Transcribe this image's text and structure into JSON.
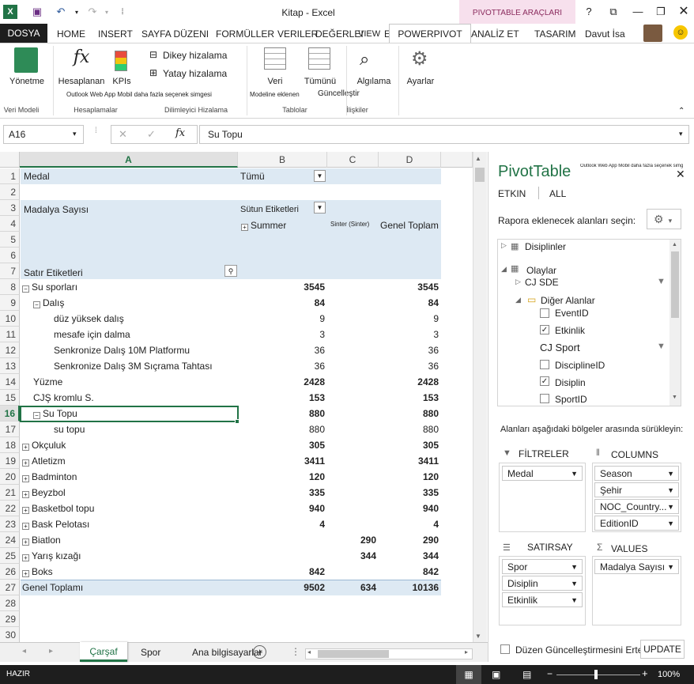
{
  "window": {
    "title": "Kitap - Excel",
    "tools_label": "PIVOTTABLE ARAÇLARI",
    "help": "?",
    "user": "Davut İsa"
  },
  "tabs": {
    "file": "DOSYA",
    "items": [
      "HOME",
      "INSERT",
      "SAYFA DÜZENI",
      "FORMÜLLER",
      "VERILER",
      "DEĞERLEI",
      "VIEW",
      "E"
    ],
    "powerpivot": "POWERPIVOT işlevi",
    "analyze": "ANALİZ ET",
    "design": "TASARIM"
  },
  "ribbon": {
    "manage": "Yönetme",
    "calc": "Hesaplanan",
    "kpis": "KPIs",
    "vertical": "Dikey hizalama",
    "horizontal": "Yatay hizalama",
    "outlook_note": "Outlook Web App Mobil daha fazla seçenek simgesi",
    "data": "Veri",
    "refresh": "Tümünü",
    "model_note": "Modeline eklenen",
    "refresh2": "Güncelleştir",
    "detect": "Algılama",
    "settings": "Ayarlar",
    "groups": {
      "model": "Veri Modeli",
      "calc": "Hesaplamalar",
      "slicer": "Dilimleyici Hizalama",
      "tables": "Tablolar",
      "relations": "İlişkiler"
    }
  },
  "formula": {
    "namebox": "A16",
    "fx": "fx",
    "value": "Su Topu"
  },
  "columns": [
    "A",
    "B",
    "C",
    "D"
  ],
  "rows": [
    "1",
    "2",
    "3",
    "4",
    "5",
    "6",
    "7",
    "8",
    "9",
    "10",
    "11",
    "12",
    "13",
    "14",
    "15",
    "16",
    "17",
    "18",
    "19",
    "20",
    "21",
    "22",
    "23",
    "24",
    "25",
    "26",
    "27",
    "28",
    "29",
    "30"
  ],
  "pivot": {
    "r1a": "Medal",
    "r1b": "Tümü",
    "r3a": "Madalya Sayısı",
    "r3b": "Sütun Etiketleri",
    "r4b": "Summer",
    "r4c": "Sinter (Sinter)",
    "r4d": "Genel Toplam",
    "r7a": "Satır Etiketleri",
    "lines": [
      {
        "label": "Su sporları",
        "b": "3545",
        "c": "",
        "d": "3545"
      },
      {
        "label": "Dalış",
        "b": "84",
        "c": "",
        "d": "84"
      },
      {
        "label": "düz yüksek dalış",
        "b": "9",
        "c": "",
        "d": "9"
      },
      {
        "label": "mesafe için dalma",
        "b": "3",
        "c": "",
        "d": "3"
      },
      {
        "label": "Senkronize Dalış 10M Platformu",
        "b": "36",
        "c": "",
        "d": "36"
      },
      {
        "label": "Senkronize Dalış 3M Sıçrama Tahtası",
        "b": "36",
        "c": "",
        "d": "36"
      },
      {
        "label": "Yüzme",
        "b": "2428",
        "c": "",
        "d": "2428"
      },
      {
        "label": "CJŞ kromlu S.",
        "b": "153",
        "c": "",
        "d": "153"
      },
      {
        "label": "Su Topu",
        "b": "880",
        "c": "",
        "d": "880"
      },
      {
        "label": "su topu",
        "b": "880",
        "c": "",
        "d": "880"
      },
      {
        "label": "Okçuluk",
        "b": "305",
        "c": "",
        "d": "305"
      },
      {
        "label": "Atletizm",
        "b": "3411",
        "c": "",
        "d": "3411"
      },
      {
        "label": "Badminton",
        "b": "120",
        "c": "",
        "d": "120"
      },
      {
        "label": "Beyzbol",
        "b": "335",
        "c": "",
        "d": "335"
      },
      {
        "label": "Basketbol topu",
        "b": "940",
        "c": "",
        "d": "940"
      },
      {
        "label": "Bask Pelotası",
        "b": "4",
        "c": "",
        "d": "4"
      },
      {
        "label": "Biatlon",
        "b": "",
        "c": "290",
        "d": "290"
      },
      {
        "label": "Yarış kızağı",
        "b": "",
        "c": "344",
        "d": "344"
      },
      {
        "label": "Boks",
        "b": "842",
        "c": "",
        "d": "842"
      },
      {
        "label": "Genel Toplamı",
        "b": "9502",
        "c": "634",
        "d": "10136"
      }
    ]
  },
  "pane": {
    "title": "PivotTable",
    "note": "Outlook Web App Mobil daha fazla seçenek simgesi",
    "tab_active": "ETKIN",
    "tab_all": "ALL",
    "choose": "Rapora eklenecek alanları seçin:",
    "fields": {
      "disiplinler": "Disiplinler",
      "olaylar": "Olaylar",
      "sde": "CJ SDE",
      "diger": "Diğer Alanlar",
      "eventid": "EventID",
      "etkinlik": "Etkinlik",
      "sport": "CJ Sport",
      "disciplineid": "DisciplineID",
      "disiplin": "Disiplin",
      "sportid": "SportID"
    },
    "drag": "Alanları aşağıdaki bölgeler arasında sürükleyin:",
    "filters_label": "FİLTRELER",
    "columns_label": "COLUMNS",
    "rows_label": "SATIRSAY",
    "values_label": "VALUES",
    "filter_items": [
      "Medal"
    ],
    "column_items": [
      "Season",
      "Şehir",
      "NOC_Country...",
      "EditionID"
    ],
    "row_items": [
      "Spor",
      "Disiplin",
      "Etkinlik"
    ],
    "value_items": [
      "Madalya Sayısı"
    ],
    "defer": "Düzen Güncelleştirmesini Erte",
    "update": "UPDATE"
  },
  "sheets": {
    "tabs": [
      "Çarşaf",
      "Spor",
      "Ana bilgisayarlar"
    ]
  },
  "status": {
    "ready": "HAZIR",
    "zoom": "100%"
  }
}
